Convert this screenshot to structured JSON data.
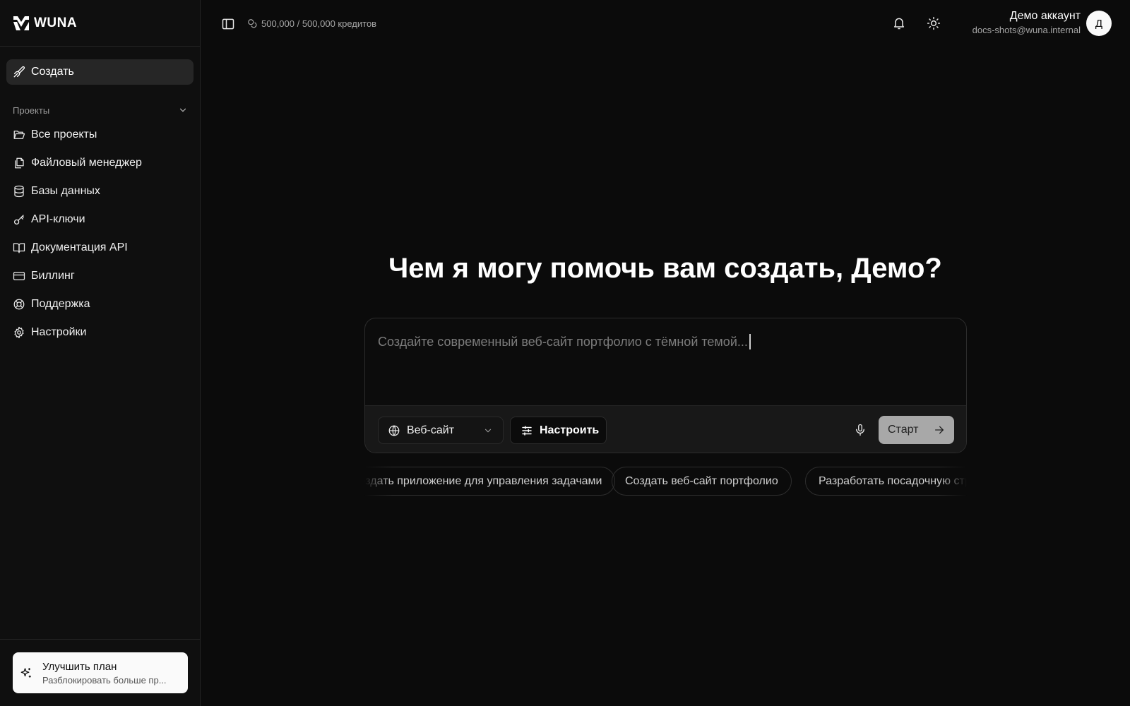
{
  "brand": {
    "name": "WUNA"
  },
  "sidebar": {
    "create_label": "Создать",
    "section_label": "Проекты",
    "items": [
      {
        "label": "Все проекты",
        "icon": "folder-open-icon"
      },
      {
        "label": "Файловый менеджер",
        "icon": "files-icon"
      },
      {
        "label": "Базы данных",
        "icon": "database-icon"
      },
      {
        "label": "API-ключи",
        "icon": "key-icon"
      },
      {
        "label": "Документация API",
        "icon": "book-open-icon"
      },
      {
        "label": "Биллинг",
        "icon": "credit-card-icon"
      },
      {
        "label": "Поддержка",
        "icon": "life-buoy-icon"
      },
      {
        "label": "Настройки",
        "icon": "gear-icon"
      }
    ],
    "upgrade": {
      "title": "Улучшить план",
      "subtitle": "Разблокировать больше пр..."
    }
  },
  "topbar": {
    "credits": "500,000 / 500,000 кредитов",
    "account_name": "Демо аккаунт",
    "account_email": "docs-shots@wuna.internal",
    "avatar_initial": "Д"
  },
  "main": {
    "headline": "Чем я могу помочь вам создать, Демо?",
    "prompt_placeholder": "Создайте современный веб-сайт портфолио с тёмной темой...",
    "type_label": "Веб-сайт",
    "tune_label": "Настроить",
    "start_label": "Старт",
    "suggestions": [
      "Создать приложение для управления задачами",
      "Создать веб-сайт портфолио",
      "Разработать посадочную страницу"
    ]
  },
  "colors": {
    "background": "#0b0b0b",
    "sidebar": "#0f0f0f",
    "active_item": "#262626",
    "start_button": "#a8a8a8",
    "upgrade_card": "#fafafa"
  }
}
